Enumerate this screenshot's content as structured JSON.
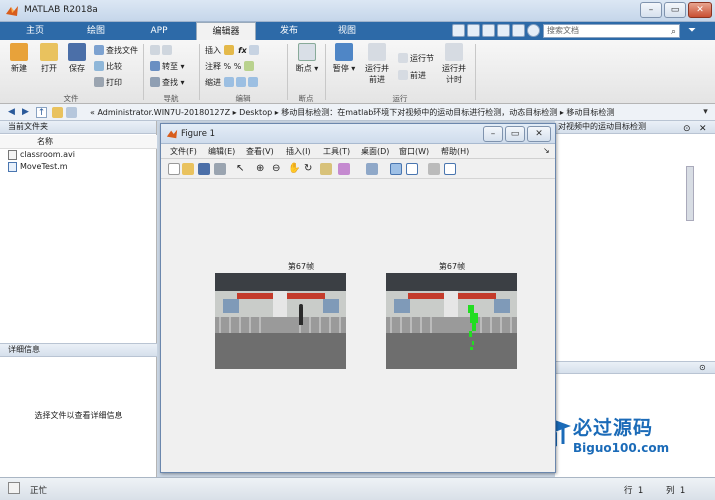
{
  "app": {
    "title": "MATLAB R2018a"
  },
  "tabs": [
    {
      "label": "主页"
    },
    {
      "label": "绘图"
    },
    {
      "label": "APP"
    },
    {
      "label": "编辑器"
    },
    {
      "label": "发布"
    },
    {
      "label": "视图"
    }
  ],
  "search": {
    "placeholder": "搜索文档"
  },
  "ribbon": {
    "file_group": {
      "label": "文件",
      "new": "新建",
      "open": "打开",
      "save": "保存",
      "find_files": "查找文件",
      "compare": "比较",
      "print": "打印"
    },
    "nav_group": {
      "label": "导航",
      "goto": "转至",
      "find": "查找"
    },
    "edit_group": {
      "label": "编辑",
      "insert": "插入",
      "comment": "注释",
      "indent": "缩进"
    },
    "breakpoint_group": {
      "label": "断点",
      "breakpoint": "断点"
    },
    "run_group": {
      "label": "运行",
      "pause": "暂停",
      "run_advance": "运行并\n前进",
      "run_section": "运行节",
      "advance": "前进",
      "run_time": "运行并\n计时"
    }
  },
  "address": {
    "path": "« Administrator.WIN7U-20180127Z ▸ Desktop ▸ 移动目标检测：在matlab环境下对视频中的运动目标进行检测，动态目标检测 ▸ 移动目标检测"
  },
  "current_folder": {
    "header": "当前文件夹",
    "name_col": "名称",
    "files": [
      {
        "name": "classroom.avi"
      },
      {
        "name": "MoveTest.m"
      }
    ]
  },
  "details": {
    "header": "详细信息",
    "message": "选择文件以查看详细信息"
  },
  "right_panel": {
    "header_text": "对视频中的运动目标检测"
  },
  "status": {
    "text": "正忙",
    "line_label": "行",
    "line_value": "1",
    "col_label": "列",
    "col_value": "1"
  },
  "figure": {
    "title": "Figure 1",
    "menus": [
      "文件(F)",
      "编辑(E)",
      "查看(V)",
      "插入(I)",
      "工具(T)",
      "桌面(D)",
      "窗口(W)",
      "帮助(H)"
    ],
    "axes_titles": [
      "第67帧",
      "第67帧"
    ]
  },
  "watermark": {
    "text": "必过源码",
    "url": "Biguo100.com"
  },
  "colors": {
    "accent": "#2d6aa8",
    "watermark": "#1b6bb8",
    "detection": "#22dd22"
  }
}
